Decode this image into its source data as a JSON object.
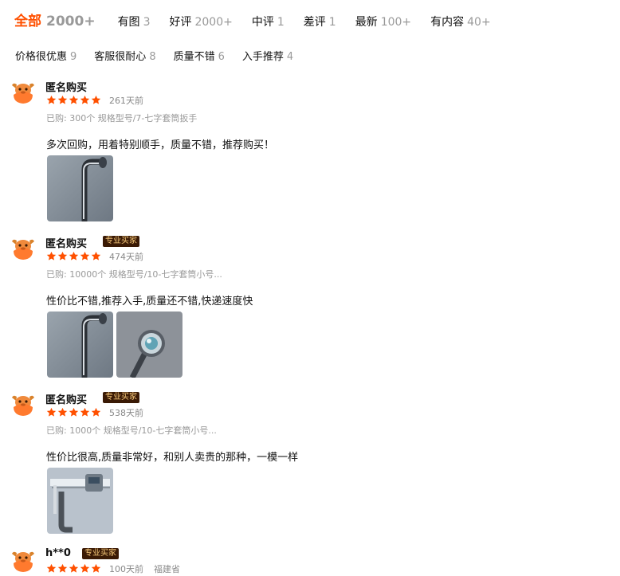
{
  "filters": {
    "tabs": [
      {
        "label": "全部",
        "count": "2000+"
      },
      {
        "label": "有图",
        "count": "3"
      },
      {
        "label": "好评",
        "count": "2000+"
      },
      {
        "label": "中评",
        "count": "1"
      },
      {
        "label": "差评",
        "count": "1"
      },
      {
        "label": "最新",
        "count": "100+"
      },
      {
        "label": "有内容",
        "count": "40+"
      }
    ],
    "tags": [
      {
        "label": "价格很优惠",
        "count": "9"
      },
      {
        "label": "客服很耐心",
        "count": "8"
      },
      {
        "label": "质量不错",
        "count": "6"
      },
      {
        "label": "入手推荐",
        "count": "4"
      }
    ]
  },
  "reviews": [
    {
      "user": "匿名购买",
      "badge": "",
      "rating": 5,
      "age": "261天前",
      "location": "",
      "spec": "已购: 300个 规格型号/7-七字套筒扳手",
      "content": "多次回购，用着特别顺手，质量不错，推荐购买！",
      "photos": [
        "wrench-photo"
      ]
    },
    {
      "user": "匿名购买",
      "badge": "专业买家",
      "rating": 5,
      "age": "474天前",
      "location": "",
      "spec": "已购: 10000个 规格型号/10-七字套筒小号...",
      "content": "性价比不错,推荐入手,质量还不错,快递速度快",
      "photos": [
        "wrench-photo",
        "socket-photo"
      ]
    },
    {
      "user": "匿名购买",
      "badge": "专业买家",
      "rating": 5,
      "age": "538天前",
      "location": "",
      "spec": "已购: 1000个 规格型号/10-七字套筒小号...",
      "content": "性价比很高,质量非常好，和别人卖贵的那种，一模一样",
      "photos": [
        "caliper-photo"
      ]
    },
    {
      "user": "h**0",
      "badge": "专业买家",
      "rating": 5,
      "age": "100天前",
      "location": "福建省",
      "spec": "",
      "content": "",
      "photos": []
    }
  ],
  "colors": {
    "accent": "#ff5000",
    "star": "#ff5000",
    "badge_bg": "#3a1a05",
    "badge_text": "#f7c97a"
  }
}
